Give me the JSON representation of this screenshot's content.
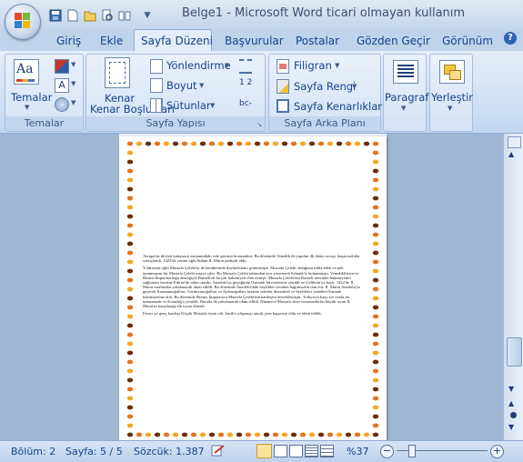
{
  "title": "Belge1 - Microsoft Word ticari olmayan kullanım",
  "qat": {
    "icons": [
      "save-icon",
      "new-icon",
      "open-icon",
      "print-preview-icon",
      "book-icon"
    ]
  },
  "tabs": [
    "Giriş",
    "Ekle",
    "Sayfa Düzeni",
    "Başvurular",
    "Postalar",
    "Gözden Geçir",
    "Görünüm"
  ],
  "ribbon": {
    "temalar": {
      "label": "Temalar",
      "group": "Temalar"
    },
    "sayfa_yapisi": {
      "kenar": "Kenar Boşlukları",
      "yonlendirme": "Yönlendirme",
      "boyut": "Boyut",
      "sutunlar": "Sütunlar",
      "group": "Sayfa Yapısı"
    },
    "arka_plan": {
      "filigran": "Filigran",
      "rengi": "Sayfa Rengi",
      "kenarliklari": "Sayfa Kenarlıkları",
      "group": "Sayfa Arka Planı"
    },
    "paragraf": "Paragraf",
    "yerlestir": "Yerleştir"
  },
  "document": {
    "paragraphs": [
      "Avrupa'da devleti kabasının zamanındaki eski gücünü korumaktır. Bu dönemde Venedik ile yapılan ilk deniz savaşı, başarısızlıkla sonuçlandı. 1423'de yerine oğlu Sultan II. Murat padişah oldu.",
      "Yıldırımın oğlu Mustafa Çelebi'yi de beraberinde Şeyhülislamı götürmüştü. Mustafa Çelebi olduğunu iddia eden ve pek tanınmayan bir Mustafa Çelebi ortaya çıktı. Bu Mustafa Çelebi tahtından ayrı yöneterek Selanik'te bulunmuştu. Venediklilerin ve Bizans İmparatorluğu desteğiyle Rumeli'de birçok hakimiyeti elde etmişti. Mustafa Çelebi'nin Rumeli üzerinde hakimiyetini sağlaması üzerine Edirne'de tahta oturdu. Anadolu'ya geçtiğinde Osmanlı kuvvetlerine yenildi ve Gelibolu'ya kaçtı. 1422'de II. Murat tarafından yakalanarak idam edildi. Bu dönemde Anadolu'daki beylikler yeniden bağımsızlık ilan etti. II. Murat Anadolu'ya geçerek Karamanoğulları, Germiyanoğulları ve Aydınoğulları üzerine seferler düzenledi ve beylikleri yeniden Osmanlı hakimiyetine aldı. Bu dönemde Bizans İmparatoru Mustafa Çelebi'nin kardeşini desteklemiştir. Trakya'ya kaçtı ise orada da tutunamadı ve Karadağ'a yöneldi. Burada da yakalanarak idam edildi. Düzmece Mustafa olayı sonrasında bu büyük isyan II. Murat'ın karşılaştığı ilk isyan olmadı.",
      "Ertesi yıl genç kardeşi Küçük Mustafa isyan etti. İznik'e ulaşmıştı ancak yine başarısız oldu ve idam edildi."
    ]
  },
  "status": {
    "bolum": "Bölüm: 2",
    "sayfa": "Sayfa: 5 / 5",
    "sozcuk": "Sözcük: 1.387",
    "zoom": "%37"
  },
  "colors": {
    "accent": "#15428b",
    "tab_active": "#e3edf9",
    "ribbon": "#dbe7f6"
  }
}
